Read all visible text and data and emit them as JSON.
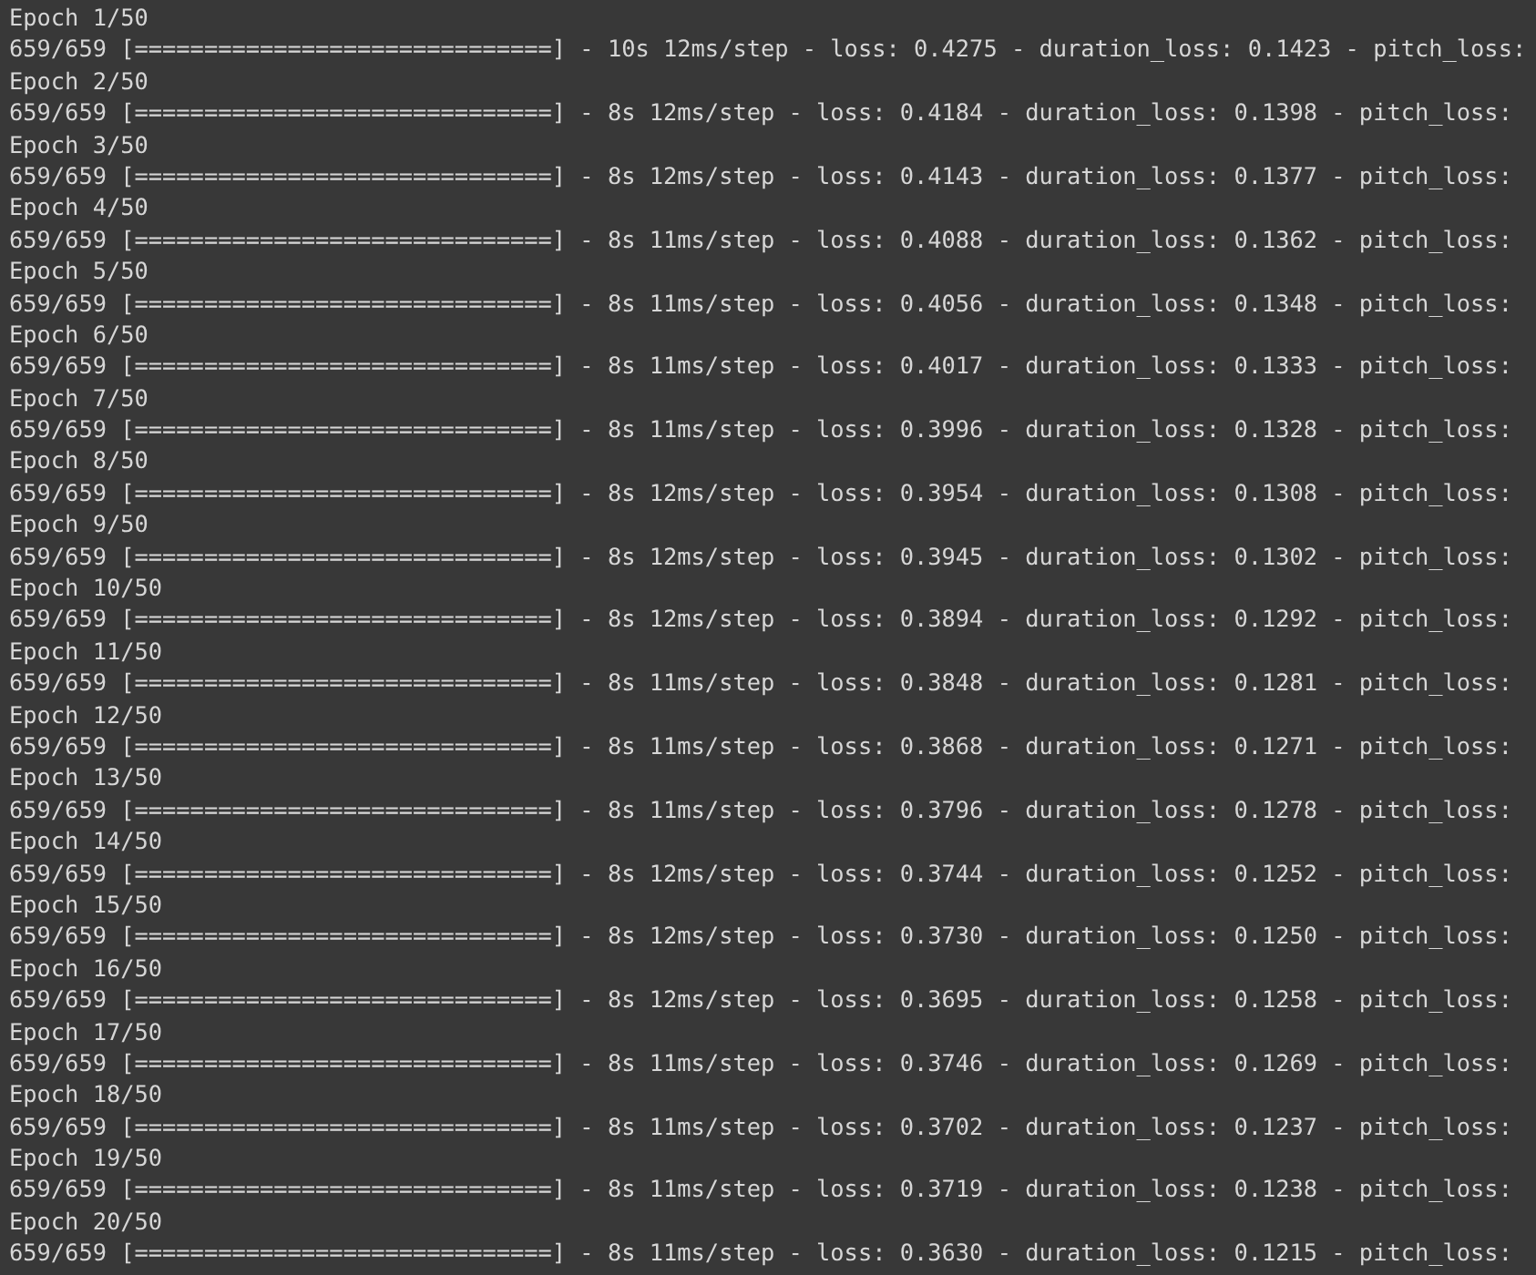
{
  "console_lines": [
    "Epoch 1/50",
    "659/659 [==============================] - 10s 12ms/step - loss: 0.4275 - duration_loss: 0.1423 - pitch_loss:",
    "Epoch 2/50",
    "659/659 [==============================] - 8s 12ms/step - loss: 0.4184 - duration_loss: 0.1398 - pitch_loss:",
    "Epoch 3/50",
    "659/659 [==============================] - 8s 12ms/step - loss: 0.4143 - duration_loss: 0.1377 - pitch_loss:",
    "Epoch 4/50",
    "659/659 [==============================] - 8s 11ms/step - loss: 0.4088 - duration_loss: 0.1362 - pitch_loss:",
    "Epoch 5/50",
    "659/659 [==============================] - 8s 11ms/step - loss: 0.4056 - duration_loss: 0.1348 - pitch_loss:",
    "Epoch 6/50",
    "659/659 [==============================] - 8s 11ms/step - loss: 0.4017 - duration_loss: 0.1333 - pitch_loss:",
    "Epoch 7/50",
    "659/659 [==============================] - 8s 11ms/step - loss: 0.3996 - duration_loss: 0.1328 - pitch_loss:",
    "Epoch 8/50",
    "659/659 [==============================] - 8s 12ms/step - loss: 0.3954 - duration_loss: 0.1308 - pitch_loss:",
    "Epoch 9/50",
    "659/659 [==============================] - 8s 12ms/step - loss: 0.3945 - duration_loss: 0.1302 - pitch_loss:",
    "Epoch 10/50",
    "659/659 [==============================] - 8s 12ms/step - loss: 0.3894 - duration_loss: 0.1292 - pitch_loss:",
    "Epoch 11/50",
    "659/659 [==============================] - 8s 11ms/step - loss: 0.3848 - duration_loss: 0.1281 - pitch_loss:",
    "Epoch 12/50",
    "659/659 [==============================] - 8s 11ms/step - loss: 0.3868 - duration_loss: 0.1271 - pitch_loss:",
    "Epoch 13/50",
    "659/659 [==============================] - 8s 11ms/step - loss: 0.3796 - duration_loss: 0.1278 - pitch_loss:",
    "Epoch 14/50",
    "659/659 [==============================] - 8s 12ms/step - loss: 0.3744 - duration_loss: 0.1252 - pitch_loss:",
    "Epoch 15/50",
    "659/659 [==============================] - 8s 12ms/step - loss: 0.3730 - duration_loss: 0.1250 - pitch_loss:",
    "Epoch 16/50",
    "659/659 [==============================] - 8s 12ms/step - loss: 0.3695 - duration_loss: 0.1258 - pitch_loss:",
    "Epoch 17/50",
    "659/659 [==============================] - 8s 11ms/step - loss: 0.3746 - duration_loss: 0.1269 - pitch_loss:",
    "Epoch 18/50",
    "659/659 [==============================] - 8s 11ms/step - loss: 0.3702 - duration_loss: 0.1237 - pitch_loss:",
    "Epoch 19/50",
    "659/659 [==============================] - 8s 11ms/step - loss: 0.3719 - duration_loss: 0.1238 - pitch_loss:",
    "Epoch 20/50",
    "659/659 [==============================] - 8s 11ms/step - loss: 0.3630 - duration_loss: 0.1215 - pitch_loss:"
  ]
}
